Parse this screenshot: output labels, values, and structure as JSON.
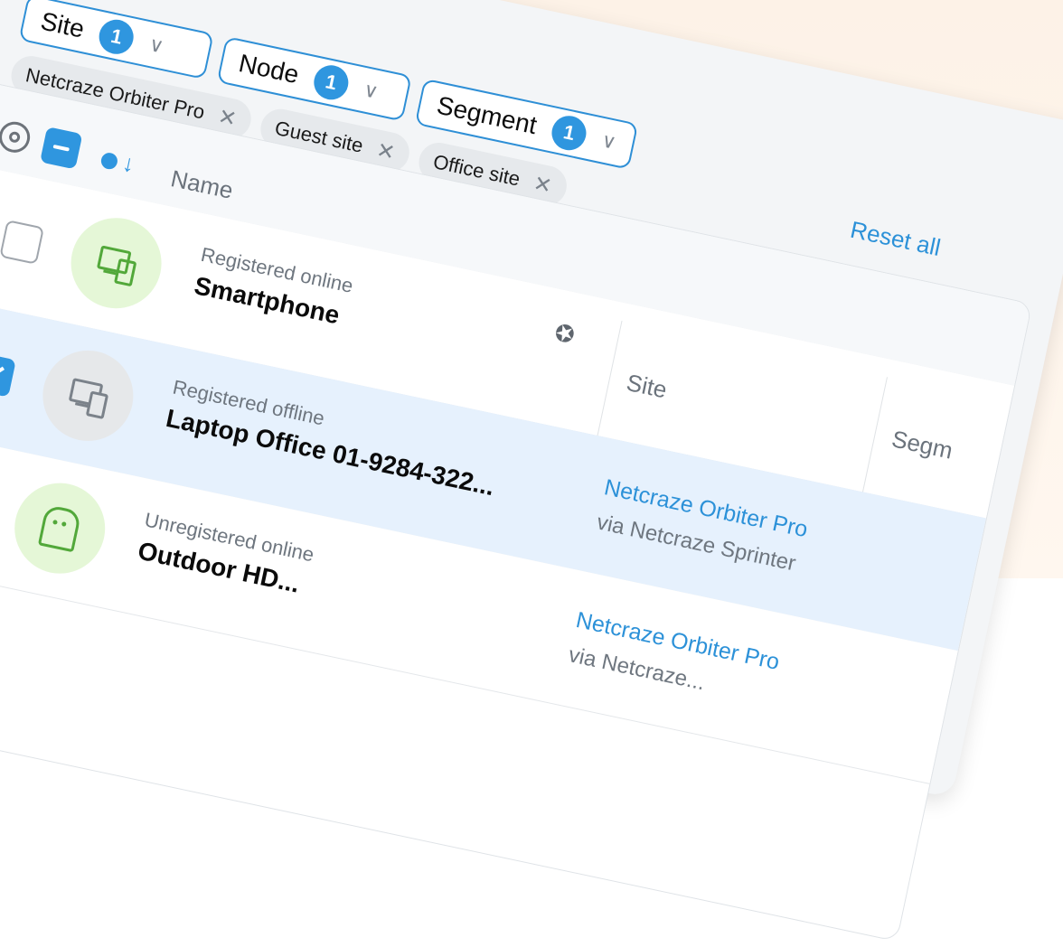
{
  "filters": {
    "items": [
      {
        "label": "Site",
        "count": "1"
      },
      {
        "label": "Node",
        "count": "1"
      },
      {
        "label": "Segment",
        "count": "1"
      }
    ],
    "reset_label": "Reset all"
  },
  "chips": [
    {
      "label": "Netcraze Orbiter Pro"
    },
    {
      "label": "Guest site"
    },
    {
      "label": "Office site"
    }
  ],
  "table": {
    "columns": {
      "name": "Name",
      "site": "Site",
      "segment": "Segm"
    },
    "rows": [
      {
        "status": "Registered online",
        "name": "Smartphone",
        "selected": false,
        "site": "",
        "via": ""
      },
      {
        "status": "Registered offline",
        "name": "Laptop Office 01-9284-322...",
        "selected": true,
        "site": "Netcraze Orbiter Pro",
        "via": "via Netcraze Sprinter"
      },
      {
        "status": "Unregistered online",
        "name": "Outdoor HD...",
        "selected": false,
        "site": "Netcraze Orbiter Pro",
        "via": "via Netcraze..."
      }
    ]
  },
  "icons": {
    "settings": "gear-icon",
    "sort": "sort-down-icon",
    "pin": "pin-icon",
    "device": "device-icon",
    "ghost": "ghost-icon",
    "close": "close-icon",
    "chevron": "chevron-down-icon"
  },
  "colors": {
    "accent": "#2f96df",
    "green": "#52a83a",
    "selected_row": "#e6f1fd"
  }
}
